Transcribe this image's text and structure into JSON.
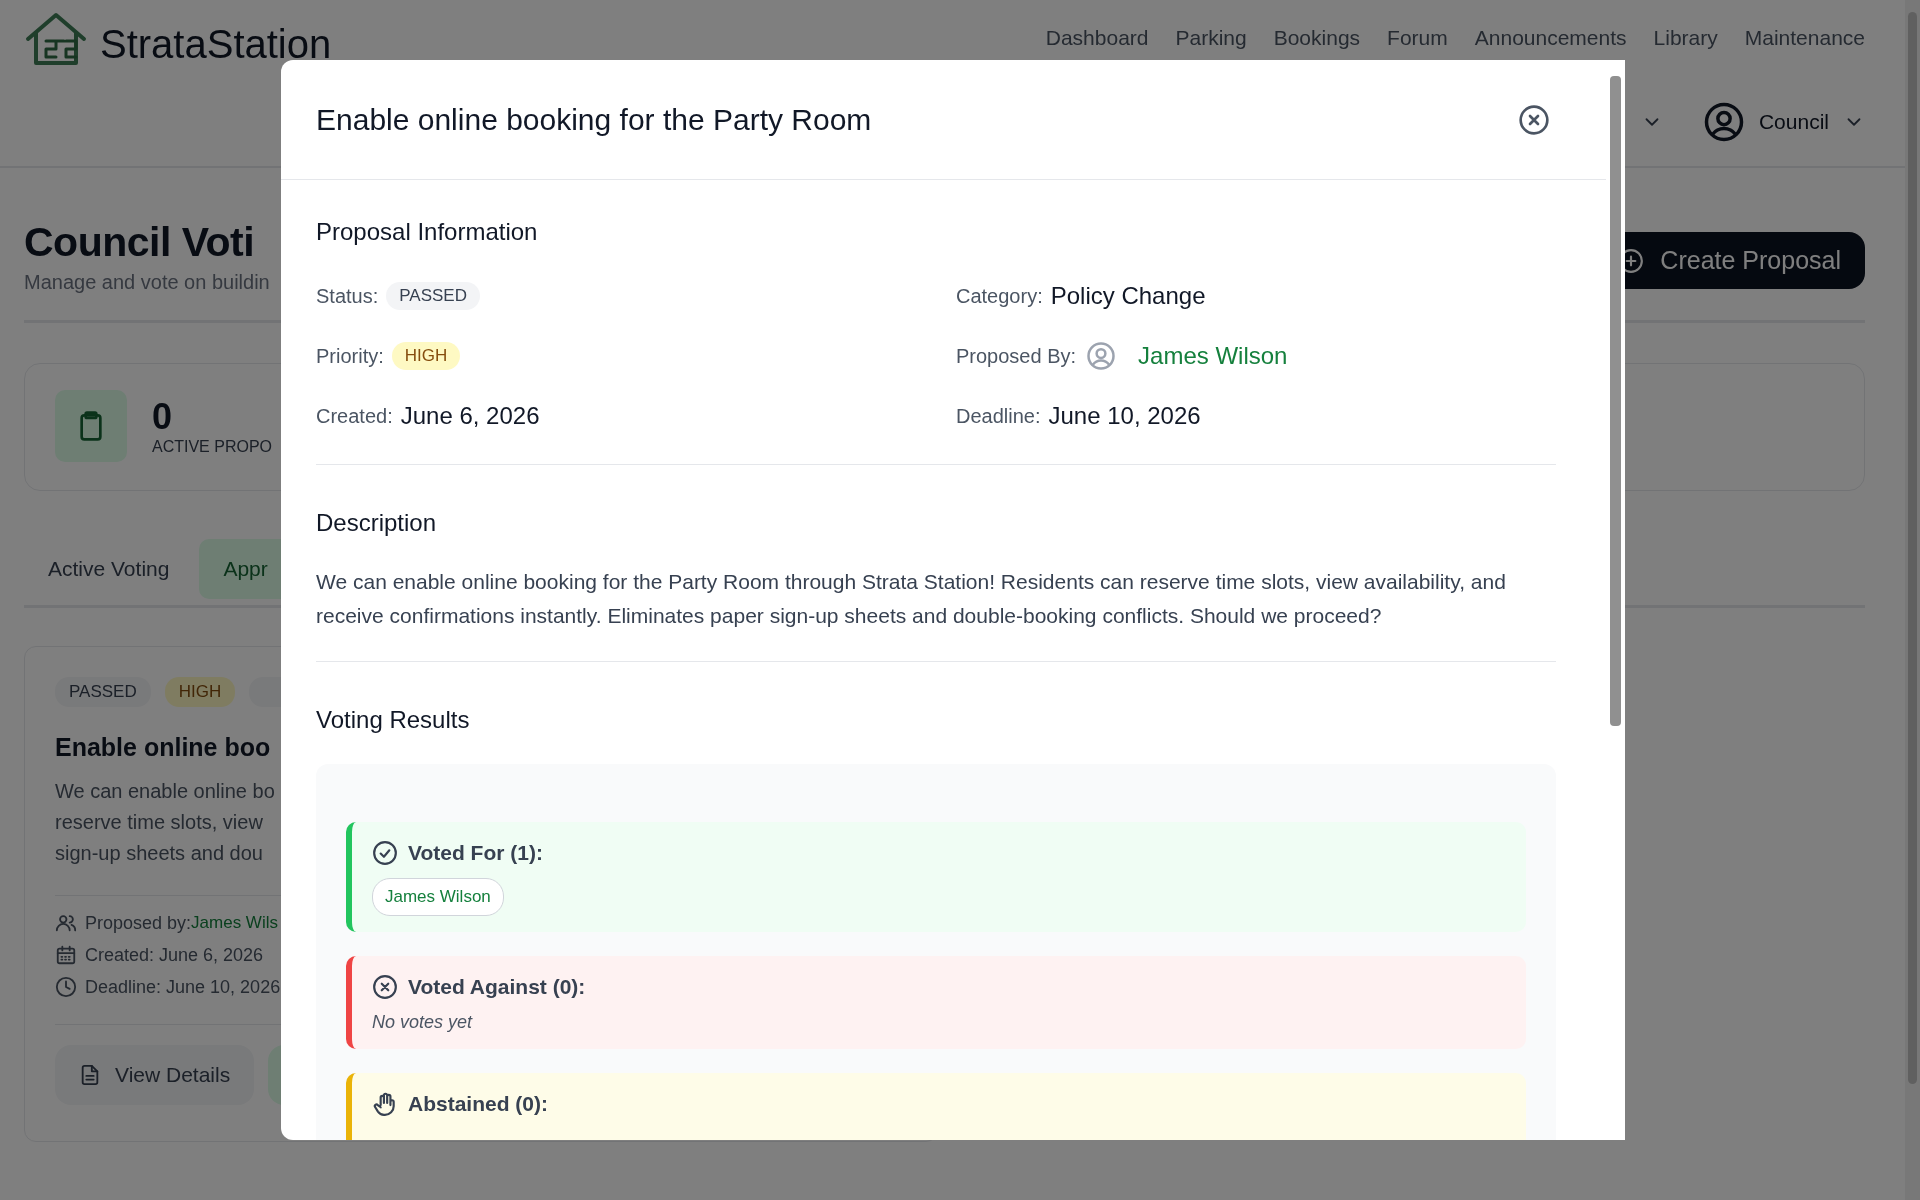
{
  "header": {
    "logo_text": "StrataStation",
    "nav": [
      "Dashboard",
      "Parking",
      "Bookings",
      "Forum",
      "Announcements",
      "Library",
      "Maintenance"
    ],
    "user_menu": "Council"
  },
  "page": {
    "title": "Council Voti",
    "subtitle": "Manage and vote on buildin",
    "create_button": "Create Proposal",
    "stats": [
      {
        "value": "0",
        "label": "ACTIVE PROPO"
      }
    ],
    "tabs": [
      {
        "label": "Active Voting",
        "selected": false
      },
      {
        "label": "Appr",
        "selected": true
      }
    ],
    "card": {
      "badges": [
        {
          "label": "PASSED",
          "kind": "status"
        },
        {
          "label": "HIGH",
          "kind": "priority"
        }
      ],
      "title": "Enable online boo",
      "description_lines": [
        "We can enable online bo",
        "reserve time slots, view",
        "sign-up sheets and dou"
      ],
      "meta": [
        {
          "kind": "person",
          "label": "Proposed by:",
          "value": "James Wils"
        },
        {
          "kind": "calendar",
          "label": "Created: June 6, 2026"
        },
        {
          "kind": "clock",
          "label": "Deadline: June 10, 2026"
        }
      ],
      "buttons": [
        "View Details"
      ]
    }
  },
  "modal": {
    "title": "Enable online booking for the Party Room",
    "info_heading": "Proposal Information",
    "fields": [
      {
        "label": "Status:",
        "value": "PASSED",
        "kind": "status"
      },
      {
        "label": "Category:",
        "value": "Policy Change",
        "kind": "text"
      },
      {
        "label": "Priority:",
        "value": "HIGH",
        "kind": "priority"
      },
      {
        "label": "Proposed By:",
        "value": "James Wilson",
        "kind": "person"
      },
      {
        "label": "Created:",
        "value": "June 6, 2026",
        "kind": "text"
      },
      {
        "label": "Deadline:",
        "value": "June 10, 2026",
        "kind": "text"
      }
    ],
    "description_heading": "Description",
    "description": "We can enable online booking for the Party Room through Strata Station! Residents can reserve time slots, view availability, and receive confirmations instantly. Eliminates paper sign-up sheets and double-booking conflicts. Should we proceed?",
    "voting_heading": "Voting Results",
    "vote_groups": [
      {
        "kind": "for",
        "title": "Voted For (1):",
        "voters": [
          "James Wilson"
        ]
      },
      {
        "kind": "against",
        "title": "Voted Against (0):",
        "empty_text": "No votes yet"
      },
      {
        "kind": "abstain",
        "title": "Abstained (0):"
      }
    ]
  }
}
